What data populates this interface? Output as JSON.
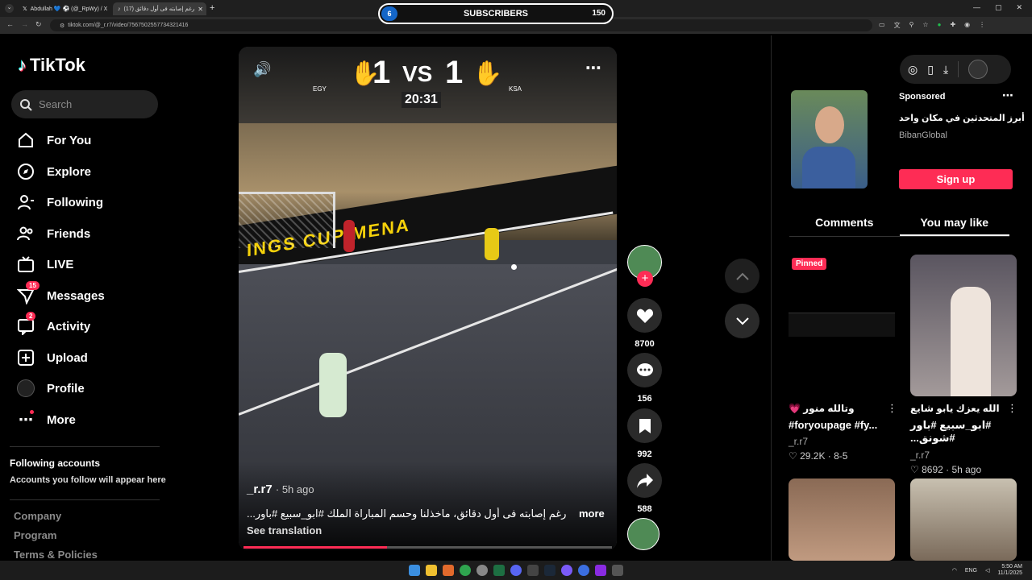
{
  "browser": {
    "tabs": [
      {
        "label": "Abdullah 💙 ⚽ (@_RpWy) / X"
      },
      {
        "label": "رغم إصابته فى أول دقائق (17)"
      }
    ],
    "url": "tiktok.com/@_r.r7/video/7567502557734321416"
  },
  "overlay": {
    "left": "6",
    "title": "SUBSCRIBERS",
    "right": "150"
  },
  "sidebar": {
    "brand": "TikTok",
    "search_placeholder": "Search",
    "items": [
      {
        "label": "For You"
      },
      {
        "label": "Explore"
      },
      {
        "label": "Following"
      },
      {
        "label": "Friends"
      },
      {
        "label": "LIVE"
      },
      {
        "label": "Messages",
        "badge": "15"
      },
      {
        "label": "Activity",
        "badge": "2"
      },
      {
        "label": "Upload"
      },
      {
        "label": "Profile"
      },
      {
        "label": "More"
      }
    ],
    "following_title": "Following accounts",
    "following_sub": "Accounts you follow will appear here",
    "footer": [
      "Company",
      "Program",
      "Terms & Policies"
    ]
  },
  "video": {
    "score_left": "1",
    "score_vs": "VS",
    "score_right": "1",
    "clock": "20:31",
    "team_left": "EGY",
    "team_right": "KSA",
    "board_text": "INGS CUP MENA",
    "author": "_r.r7",
    "age": "· 5h ago",
    "caption": "رغم إصابته فى أول دقائق، ماخذلنا وحسم المباراة الملك  #ابو_سبيع #باور...",
    "more": "more",
    "translate": "See translation",
    "progress": 0.39
  },
  "actions": {
    "likes": "8700",
    "comments": "156",
    "saves": "992",
    "shares": "588"
  },
  "right_panel": {
    "ad": {
      "sponsored": "Sponsored",
      "title": "أبرز المتحدثين في مكان واحد",
      "brand": "BibanGlobal",
      "cta": "Sign up"
    },
    "tabs": [
      "Comments",
      "You may like"
    ],
    "cards": [
      {
        "pinned": "Pinned",
        "title": "وتالله منور 💗",
        "tags": "#foryoupage #fy...",
        "author": "_r.r7",
        "stats": "29.2K · 8-5"
      },
      {
        "title": "الله يعزك يابو شايع",
        "tags": "#ابو_سبيع #باور #شونق...",
        "author": "_r.r7",
        "stats": "8692 · 5h ago"
      }
    ]
  },
  "taskbar": {
    "lang": "ENG",
    "time": "5:50 AM",
    "date": "11/1/2025"
  },
  "colors": {
    "accent": "#fe2c55",
    "bg": "#000000",
    "panel": "#1f1f1f"
  }
}
